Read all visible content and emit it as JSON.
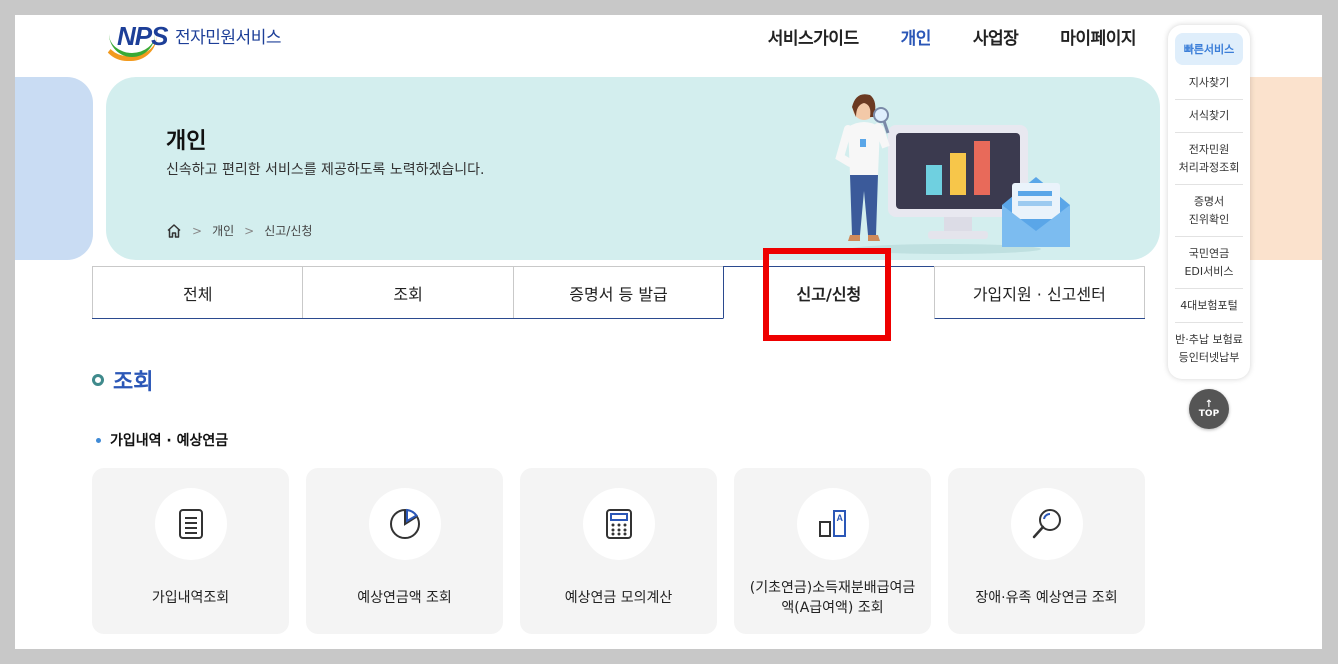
{
  "header": {
    "logo_text": "NPS",
    "logo_sub": "전자민원서비스",
    "nav": [
      "서비스가이드",
      "개인",
      "사업장",
      "마이페이지"
    ],
    "active_nav": 1
  },
  "hero": {
    "title": "개인",
    "description": "신속하고 편리한 서비스를 제공하도록 노력하겠습니다.",
    "breadcrumb": [
      "개인",
      "신고/신청"
    ]
  },
  "tabs": [
    "전체",
    "조회",
    "증명서 등 발급",
    "신고/신청",
    "가입지원 · 신고센터"
  ],
  "active_tab": 3,
  "section": {
    "title": "조회",
    "subtitle": "가입내역 · 예상연금",
    "cards": [
      {
        "label": "가입내역조회",
        "icon": "document-icon"
      },
      {
        "label": "예상연금액 조회",
        "icon": "pie-chart-icon"
      },
      {
        "label": "예상연금 모의계산",
        "icon": "calculator-icon"
      },
      {
        "label": "(기초연금)소득재분배급여금액(A급여액) 조회",
        "icon": "bar-a-icon"
      },
      {
        "label": "장애·유족 예상연금 조회",
        "icon": "magnifier-icon"
      }
    ]
  },
  "quick": {
    "title": "빠른서비스",
    "items": [
      [
        "지사찾기"
      ],
      [
        "서식찾기"
      ],
      [
        "전자민원",
        "처리과정조회"
      ],
      [
        "증명서",
        "진위확인"
      ],
      [
        "국민연금",
        "EDI서비스"
      ],
      [
        "4대보험포털"
      ],
      [
        "반·추납 보험료",
        "등인터넷납부"
      ]
    ],
    "top_label": "TOP"
  },
  "colors": {
    "accent": "#2b57b7",
    "hero_bg": "#d3eeee",
    "highlight": "#ee0000"
  }
}
